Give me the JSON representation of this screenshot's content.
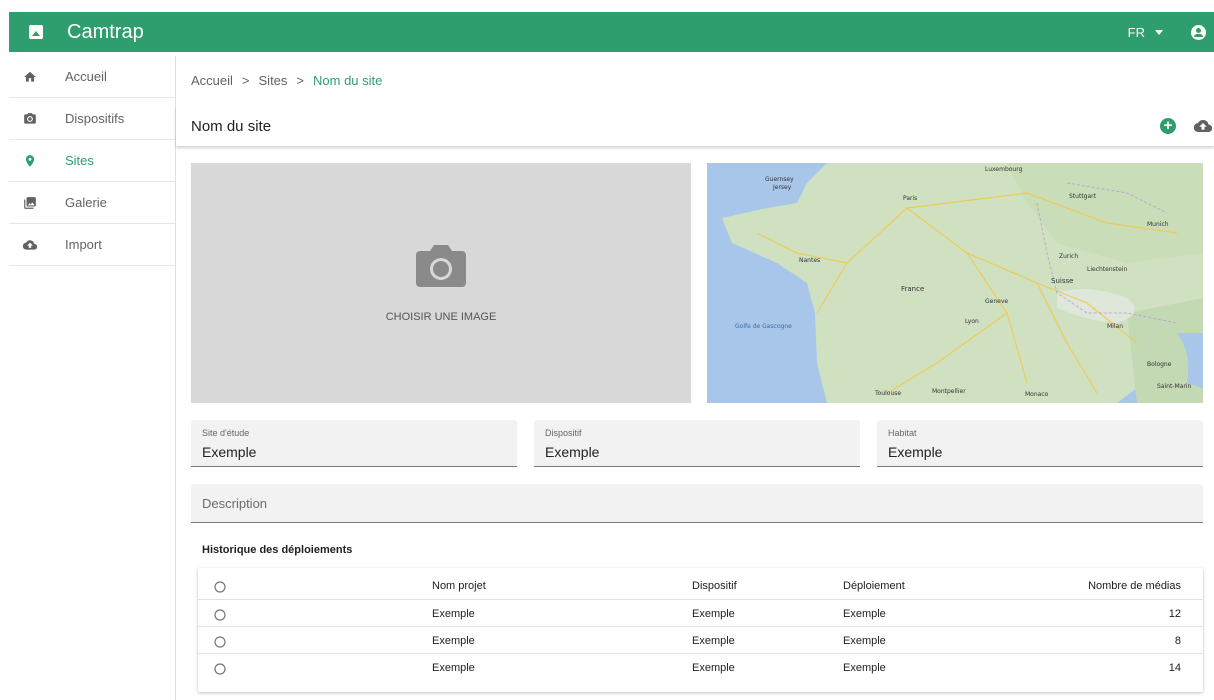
{
  "app": {
    "title": "Camtrap",
    "language": "FR"
  },
  "sidebar": {
    "items": [
      {
        "label": "Accueil",
        "icon": "home-icon"
      },
      {
        "label": "Dispositifs",
        "icon": "camera-icon"
      },
      {
        "label": "Sites",
        "icon": "location-pin-icon",
        "active": true
      },
      {
        "label": "Galerie",
        "icon": "gallery-icon"
      },
      {
        "label": "Import",
        "icon": "cloud-upload-icon"
      }
    ]
  },
  "breadcrumb": {
    "items": [
      "Accueil",
      "Sites",
      "Nom du site"
    ],
    "separator": ">"
  },
  "page": {
    "title": "Nom du site"
  },
  "image_panel": {
    "label": "CHOISIR UNE IMAGE"
  },
  "map": {
    "labels": [
      "Luxembourg",
      "Guernsey",
      "Jersey",
      "Paris",
      "Stuttgart",
      "Munich",
      "Zurich",
      "Liechtenstein",
      "Nantes",
      "France",
      "Suisse",
      "Geneve",
      "Lyon",
      "Milan",
      "Golfe de Gascogne",
      "Toulouse",
      "Montpellier",
      "Monaco",
      "Bologne",
      "Saint-Marin"
    ]
  },
  "form": {
    "site": {
      "label": "Site d'étude",
      "value": "Exemple"
    },
    "device": {
      "label": "Dispositif",
      "value": "Exemple"
    },
    "habitat": {
      "label": "Habitat",
      "value": "Exemple"
    },
    "description": {
      "placeholder": "Description"
    }
  },
  "history": {
    "title": "Historique des déploiements",
    "columns": [
      "Nom projet",
      "Dispositif",
      "Déploiement",
      "Nombre de médias"
    ],
    "rows": [
      {
        "project": "Exemple",
        "device": "Exemple",
        "deployment": "Exemple",
        "media": "12"
      },
      {
        "project": "Exemple",
        "device": "Exemple",
        "deployment": "Exemple",
        "media": "8"
      },
      {
        "project": "Exemple",
        "device": "Exemple",
        "deployment": "Exemple",
        "media": "14"
      }
    ]
  },
  "colors": {
    "primary": "#2e9e6e",
    "surface": "#f2f2f2",
    "image_placeholder": "#d8d8d8",
    "map_water": "#a7c6ea",
    "map_land": "#cfe1c0"
  }
}
